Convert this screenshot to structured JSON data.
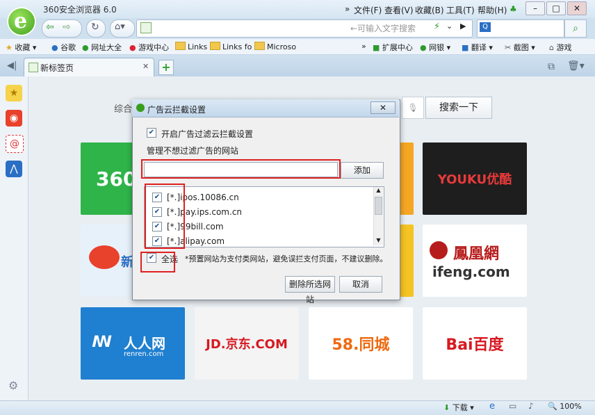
{
  "window": {
    "title": "360安全浏览器 6.0",
    "menus": [
      "文件(F)",
      "查看(V)",
      "收藏(B)",
      "工具(T)",
      "帮助(H)"
    ]
  },
  "nav": {
    "address_placeholder": "←可输入文字搜索"
  },
  "bookmarks": {
    "left": [
      "收藏",
      "谷歌",
      "网址大全",
      "游戏中心",
      "Links",
      "Links fo",
      "Microso"
    ],
    "right": [
      "扩展中心",
      "网银",
      "翻译",
      "截图",
      "游戏"
    ]
  },
  "tab": {
    "label": "新标签页"
  },
  "page": {
    "search_label": "综合",
    "search_button": "搜索一下",
    "tiles": {
      "t360": "360",
      "youku": "YOUKU优酷",
      "weibo_partial": "新",
      "ifeng_cn": "鳳凰網",
      "ifeng_en": "ifeng.com",
      "renren": "人人网",
      "renren_sub": "renren.com",
      "jd": "JD.京东.COM",
      "w58": "58.同城",
      "baidu": "Bai百度"
    }
  },
  "dialog": {
    "title": "广告云拦截设置",
    "enable_label": "开启广告过滤云拦截设置",
    "manage_label": "管理不想过滤广告的网站",
    "domain_value": "",
    "add_button": "添加",
    "sites": [
      "[*.]ipos.10086.cn",
      "[*.]pay.ips.com.cn",
      "[*.]99bill.com",
      "[*.]alipay.com"
    ],
    "select_all_label": "全选",
    "note": "*预置网站为支付类网站，避免误拦支付页面，不建议删除。",
    "delete_button": "删除所选网站",
    "cancel_button": "取消",
    "close_glyph": "✕"
  },
  "statusbar": {
    "download": "下载",
    "zoom": "100%"
  },
  "colors": {
    "accent_green": "#3a9d1b",
    "annotation_red": "#e02020"
  }
}
